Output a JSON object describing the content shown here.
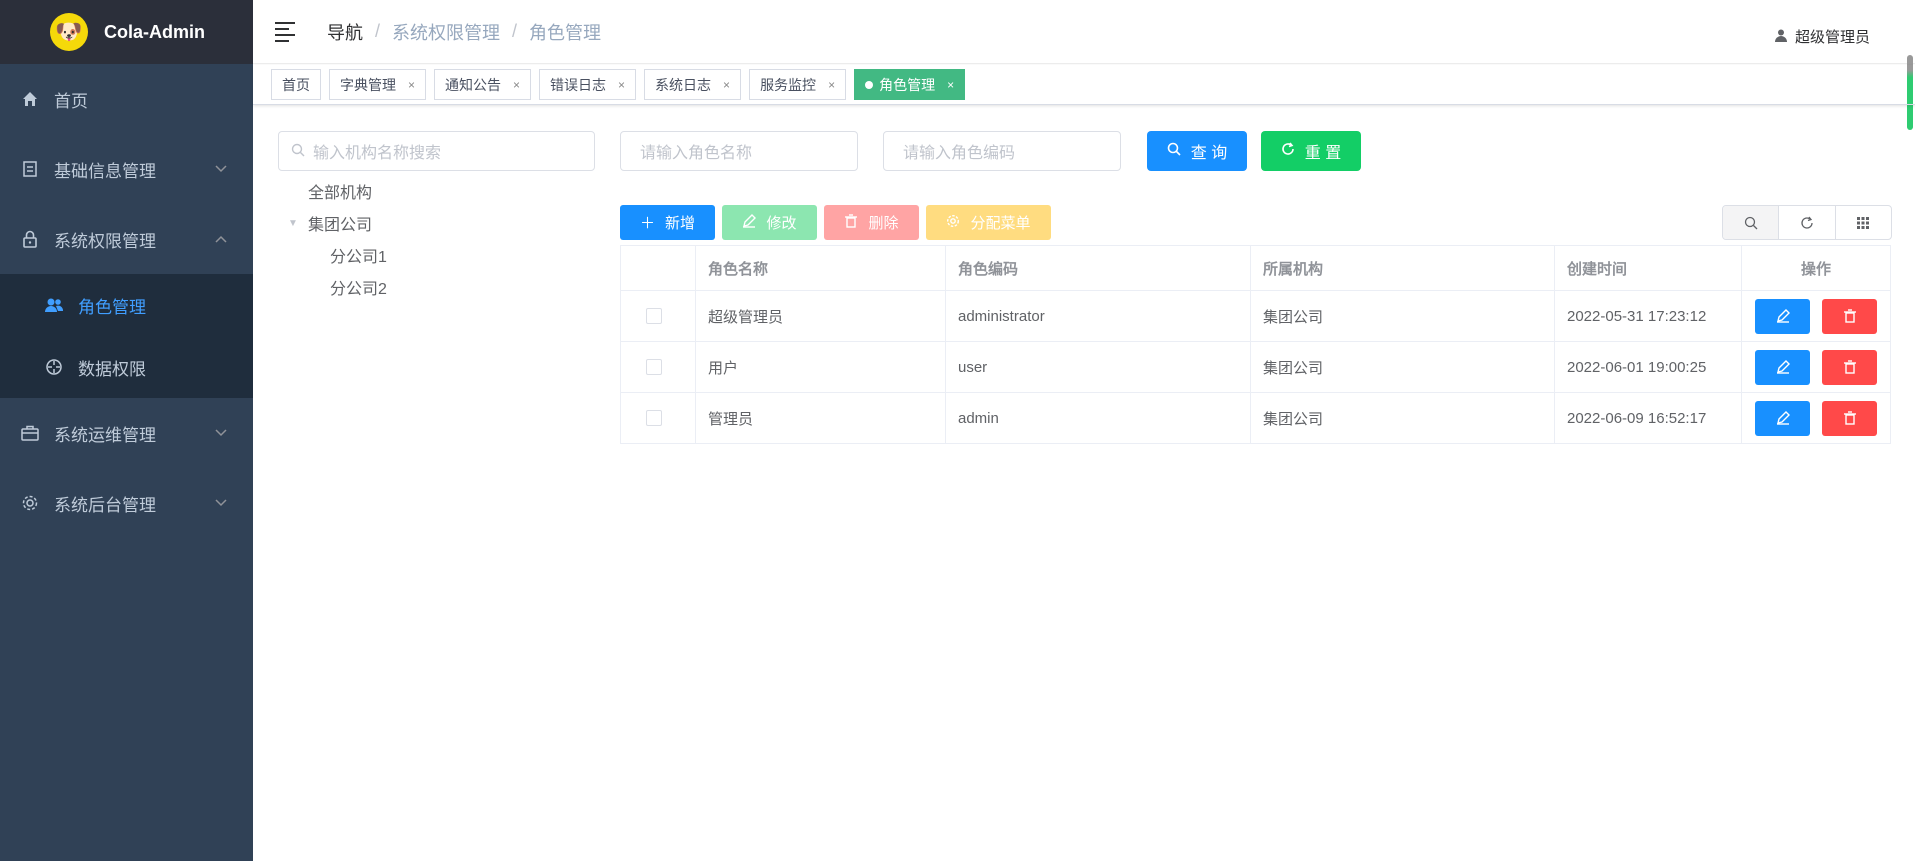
{
  "app": {
    "title": "Cola-Admin",
    "logo_icon": "dog-logo-icon"
  },
  "sidebar": {
    "items": [
      {
        "label": "首页",
        "icon": "home-icon"
      },
      {
        "label": "基础信息管理",
        "icon": "file-icon"
      },
      {
        "label": "系统权限管理",
        "icon": "lock-icon"
      },
      {
        "label": "系统运维管理",
        "icon": "briefcase-icon"
      },
      {
        "label": "系统后台管理",
        "icon": "gear-icon"
      }
    ],
    "subitems": [
      {
        "label": "角色管理",
        "icon": "user-group-icon"
      },
      {
        "label": "数据权限",
        "icon": "crosshair-icon"
      }
    ]
  },
  "header": {
    "breadcrumb": [
      "导航",
      "系统权限管理",
      "角色管理"
    ],
    "user": "超级管理员"
  },
  "tags": [
    {
      "label": "首页"
    },
    {
      "label": "字典管理"
    },
    {
      "label": "通知公告"
    },
    {
      "label": "错误日志"
    },
    {
      "label": "系统日志"
    },
    {
      "label": "服务监控"
    },
    {
      "label": "角色管理"
    }
  ],
  "tree": {
    "search_placeholder": "输入机构名称搜索",
    "nodes": [
      "全部机构",
      "集团公司",
      "分公司1",
      "分公司2"
    ]
  },
  "search": {
    "role_name_placeholder": "请输入角色名称",
    "role_code_placeholder": "请输入角色编码",
    "query_label": "查 询",
    "reset_label": "重 置"
  },
  "toolbar": {
    "add_label": "新增",
    "edit_label": "修改",
    "delete_label": "删除",
    "assign_menu_label": "分配菜单"
  },
  "table": {
    "headers": [
      "角色名称",
      "角色编码",
      "所属机构",
      "创建时间",
      "操作"
    ],
    "rows": [
      [
        "超级管理员",
        "administrator",
        "集团公司",
        "2022-05-31 17:23:12"
      ],
      [
        "用户",
        "user",
        "集团公司",
        "2022-06-01 19:00:25"
      ],
      [
        "管理员",
        "admin",
        "集团公司",
        "2022-06-09 16:52:17"
      ]
    ]
  },
  "colors": {
    "primary": "#1890ff",
    "success": "#13ce66",
    "danger": "#ff4949",
    "warning": "#ffba00",
    "tag_active": "#42b983",
    "sidebar_bg": "#304156"
  }
}
